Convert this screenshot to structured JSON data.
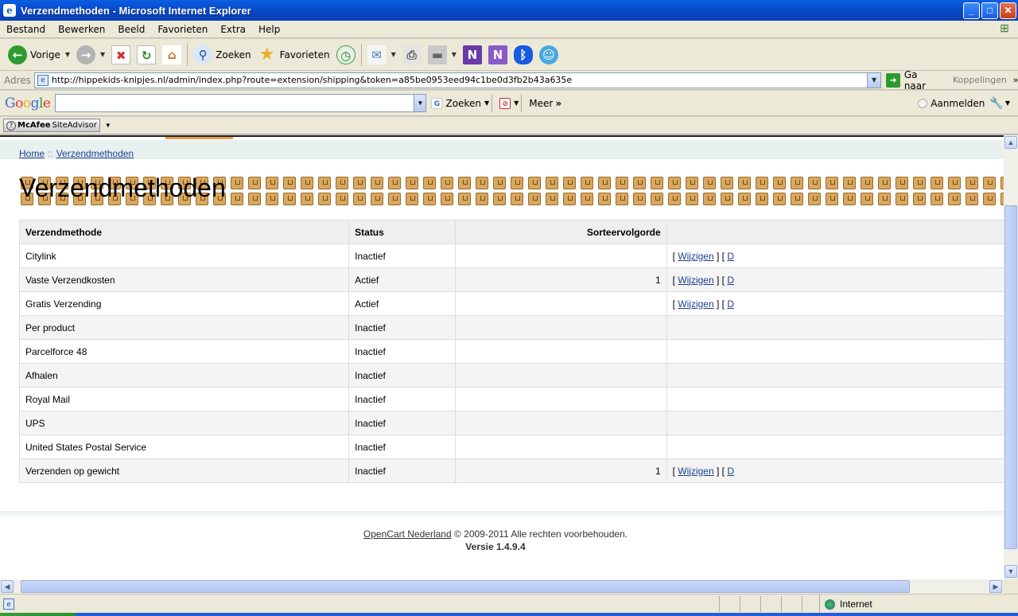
{
  "window": {
    "title": "Verzendmethoden - Microsoft Internet Explorer"
  },
  "menu": [
    "Bestand",
    "Bewerken",
    "Beeld",
    "Favorieten",
    "Extra",
    "Help"
  ],
  "toolbar": {
    "back": "Vorige",
    "search": "Zoeken",
    "favorites": "Favorieten"
  },
  "address": {
    "label": "Adres",
    "url": "http://hippekids-knipjes.nl/admin/index.php?route=extension/shipping&token=a85be0953eed94c1be0d3fb2b43a635e",
    "go": "Ga naar",
    "links": "Koppelingen"
  },
  "google": {
    "logo": "Google",
    "search": "Zoeken",
    "more": "Meer",
    "signin": "Aanmelden"
  },
  "mcafee": {
    "label": "SiteAdvisor"
  },
  "breadcrumb": {
    "home": "Home",
    "separator": "::",
    "current": "Verzendmethoden"
  },
  "page": {
    "title": "Verzendmethoden"
  },
  "table": {
    "headers": [
      "Verzendmethode",
      "Status",
      "Sorteervolgorde",
      ""
    ],
    "edit_label": "Wijzigen",
    "rows": [
      {
        "name": "Citylink",
        "status": "Inactief",
        "sort": "",
        "edit": true
      },
      {
        "name": "Vaste Verzendkosten",
        "status": "Actief",
        "sort": "1",
        "edit": true
      },
      {
        "name": "Gratis Verzending",
        "status": "Actief",
        "sort": "",
        "edit": true
      },
      {
        "name": "Per product",
        "status": "Inactief",
        "sort": "",
        "edit": false
      },
      {
        "name": "Parcelforce 48",
        "status": "Inactief",
        "sort": "",
        "edit": false
      },
      {
        "name": "Afhalen",
        "status": "Inactief",
        "sort": "",
        "edit": false
      },
      {
        "name": "Royal Mail",
        "status": "Inactief",
        "sort": "",
        "edit": false
      },
      {
        "name": "UPS",
        "status": "Inactief",
        "sort": "",
        "edit": false
      },
      {
        "name": "United States Postal Service",
        "status": "Inactief",
        "sort": "",
        "edit": false
      },
      {
        "name": "Verzenden op gewicht",
        "status": "Inactief",
        "sort": "1",
        "edit": true
      }
    ]
  },
  "footer": {
    "link": "OpenCart Nederland",
    "text": " © 2009-2011 Alle rechten voorbehouden.",
    "version": "Versie 1.4.9.4"
  },
  "status": {
    "zone": "Internet"
  },
  "icons": [
    "ie-icon",
    "back-icon",
    "forward-icon",
    "stop-icon",
    "refresh-icon",
    "home-icon",
    "search-icon",
    "favorites-icon",
    "history-icon",
    "mail-icon",
    "print-icon",
    "edit-icon",
    "onenote-icon",
    "onenote-send-icon",
    "bluetooth-icon",
    "messenger-icon",
    "windows-logo-icon",
    "globe-icon"
  ]
}
